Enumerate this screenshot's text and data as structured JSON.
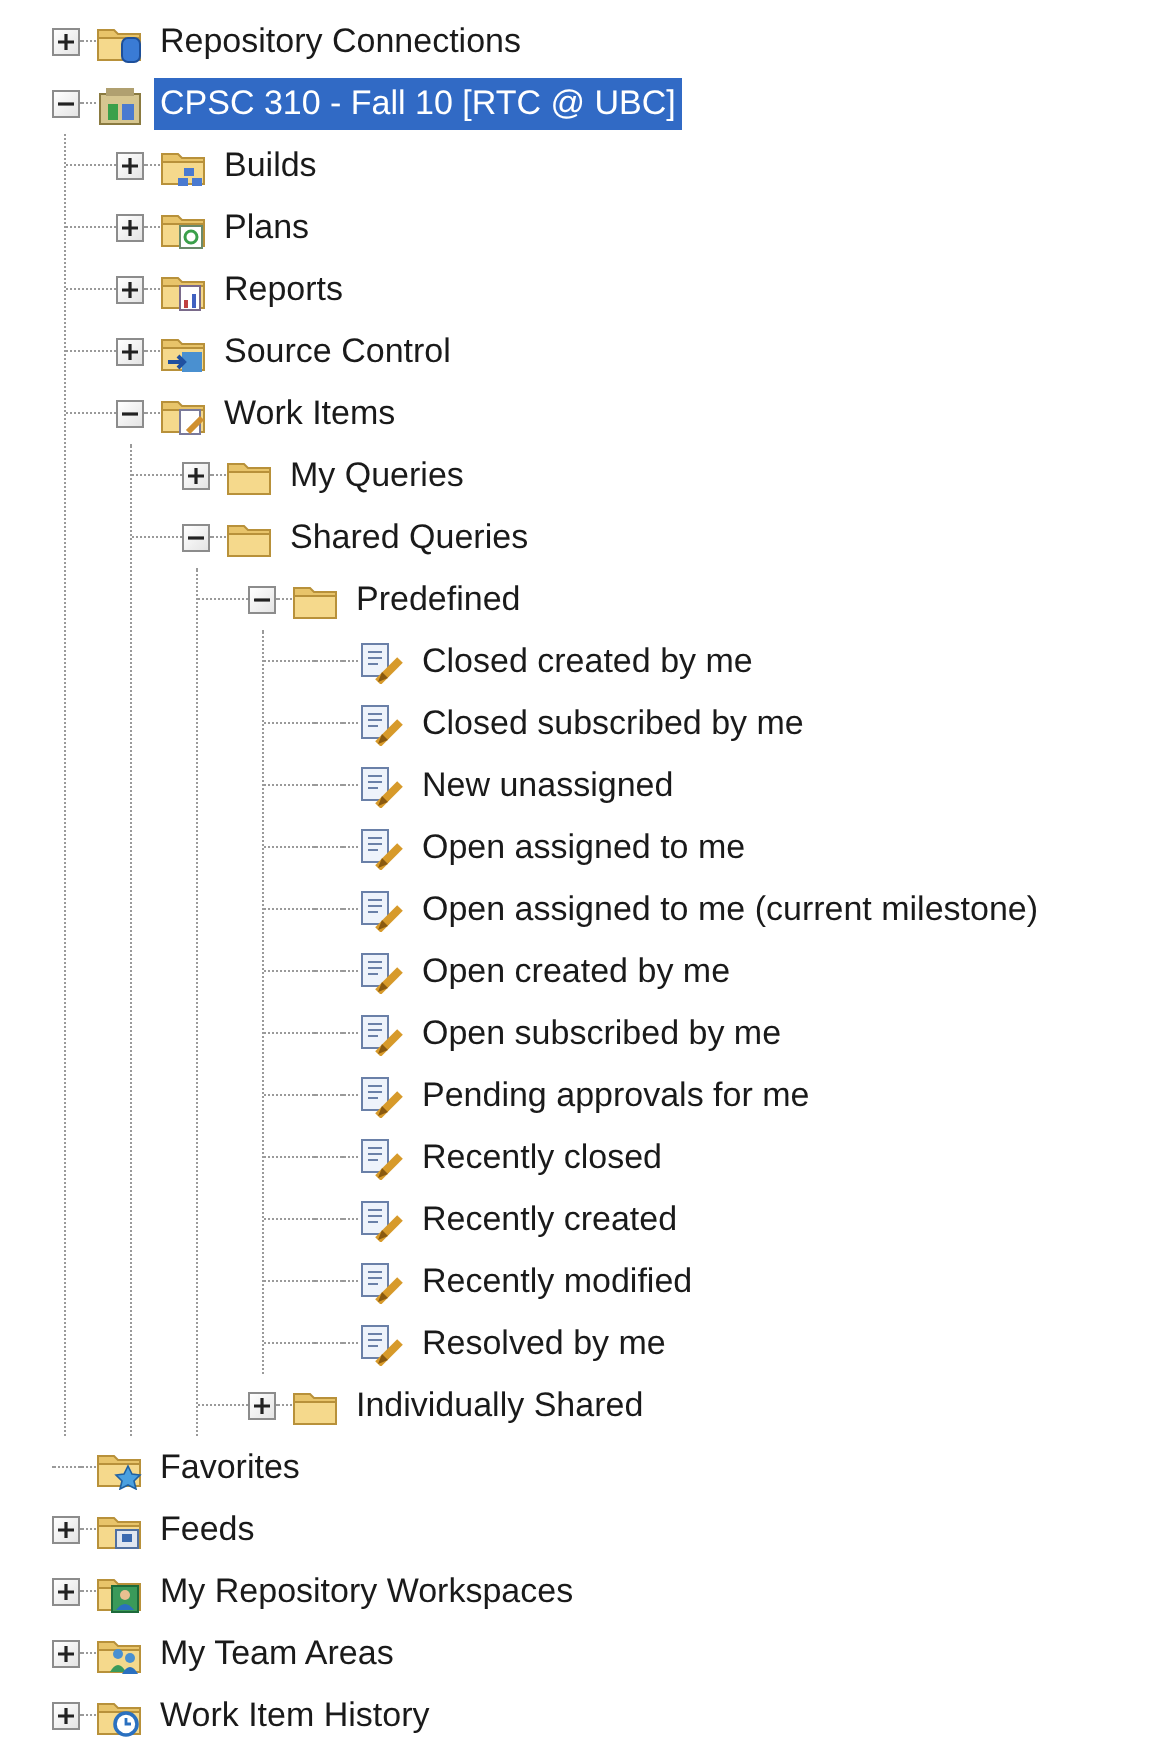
{
  "tree": [
    {
      "label": "Repository Connections",
      "kind": "repository",
      "expanded": false,
      "selected": false
    },
    {
      "label": "CPSC 310 - Fall 10 [RTC @ UBC]",
      "kind": "project",
      "expanded": true,
      "selected": true,
      "children": [
        {
          "label": "Builds",
          "kind": "builds",
          "expanded": false,
          "selected": false
        },
        {
          "label": "Plans",
          "kind": "plans",
          "expanded": false,
          "selected": false
        },
        {
          "label": "Reports",
          "kind": "reports",
          "expanded": false,
          "selected": false
        },
        {
          "label": "Source Control",
          "kind": "source-control",
          "expanded": false,
          "selected": false
        },
        {
          "label": "Work Items",
          "kind": "work-items",
          "expanded": true,
          "selected": false,
          "children": [
            {
              "label": "My Queries",
              "kind": "folder",
              "expanded": false,
              "selected": false
            },
            {
              "label": "Shared Queries",
              "kind": "folder",
              "expanded": true,
              "selected": false,
              "children": [
                {
                  "label": "Predefined",
                  "kind": "folder",
                  "expanded": true,
                  "selected": false,
                  "children": [
                    {
                      "label": "Closed created by me",
                      "kind": "query",
                      "selected": false
                    },
                    {
                      "label": "Closed subscribed by me",
                      "kind": "query",
                      "selected": false
                    },
                    {
                      "label": "New unassigned",
                      "kind": "query",
                      "selected": false
                    },
                    {
                      "label": "Open assigned to me",
                      "kind": "query",
                      "selected": false
                    },
                    {
                      "label": "Open assigned to me (current milestone)",
                      "kind": "query",
                      "selected": false
                    },
                    {
                      "label": "Open created by me",
                      "kind": "query",
                      "selected": false
                    },
                    {
                      "label": "Open subscribed by me",
                      "kind": "query",
                      "selected": false
                    },
                    {
                      "label": "Pending approvals for me",
                      "kind": "query",
                      "selected": false
                    },
                    {
                      "label": "Recently closed",
                      "kind": "query",
                      "selected": false
                    },
                    {
                      "label": "Recently created",
                      "kind": "query",
                      "selected": false
                    },
                    {
                      "label": "Recently modified",
                      "kind": "query",
                      "selected": false
                    },
                    {
                      "label": "Resolved by me",
                      "kind": "query",
                      "selected": false
                    }
                  ]
                },
                {
                  "label": "Individually Shared",
                  "kind": "folder",
                  "expanded": false,
                  "selected": false
                }
              ]
            }
          ]
        }
      ]
    },
    {
      "label": "Favorites",
      "kind": "favorites",
      "selected": false
    },
    {
      "label": "Feeds",
      "kind": "feeds",
      "expanded": false,
      "selected": false
    },
    {
      "label": "My Repository Workspaces",
      "kind": "workspaces",
      "expanded": false,
      "selected": false
    },
    {
      "label": "My Team Areas",
      "kind": "team-areas",
      "expanded": false,
      "selected": false
    },
    {
      "label": "Work Item History",
      "kind": "history",
      "expanded": false,
      "selected": false
    }
  ]
}
